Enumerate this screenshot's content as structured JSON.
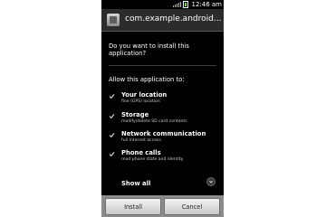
{
  "status_bar": {
    "time": "12:46 am",
    "icons": [
      "signal-icon",
      "battery-icon"
    ]
  },
  "header": {
    "app_title": "com.example.android...",
    "icon": "app-package-icon"
  },
  "prompt": {
    "question": "Do you want to install this application?",
    "allow_heading": "Allow this application to:"
  },
  "permissions": [
    {
      "title": "Your location",
      "detail": "fine (GPS) location"
    },
    {
      "title": "Storage",
      "detail": "modify/delete SD card contents"
    },
    {
      "title": "Network communication",
      "detail": "full Internet access"
    },
    {
      "title": "Phone calls",
      "detail": "read phone state and identity"
    }
  ],
  "show_all": {
    "label": "Show all",
    "icon": "chevron-down-icon"
  },
  "buttons": {
    "install": "Install",
    "cancel": "Cancel"
  },
  "colors": {
    "background": "#000000",
    "title_bar": "#2c2c2c",
    "button_bar": "#8b8b8b",
    "text": "#ffffff",
    "subtext": "#c8c8c8"
  }
}
